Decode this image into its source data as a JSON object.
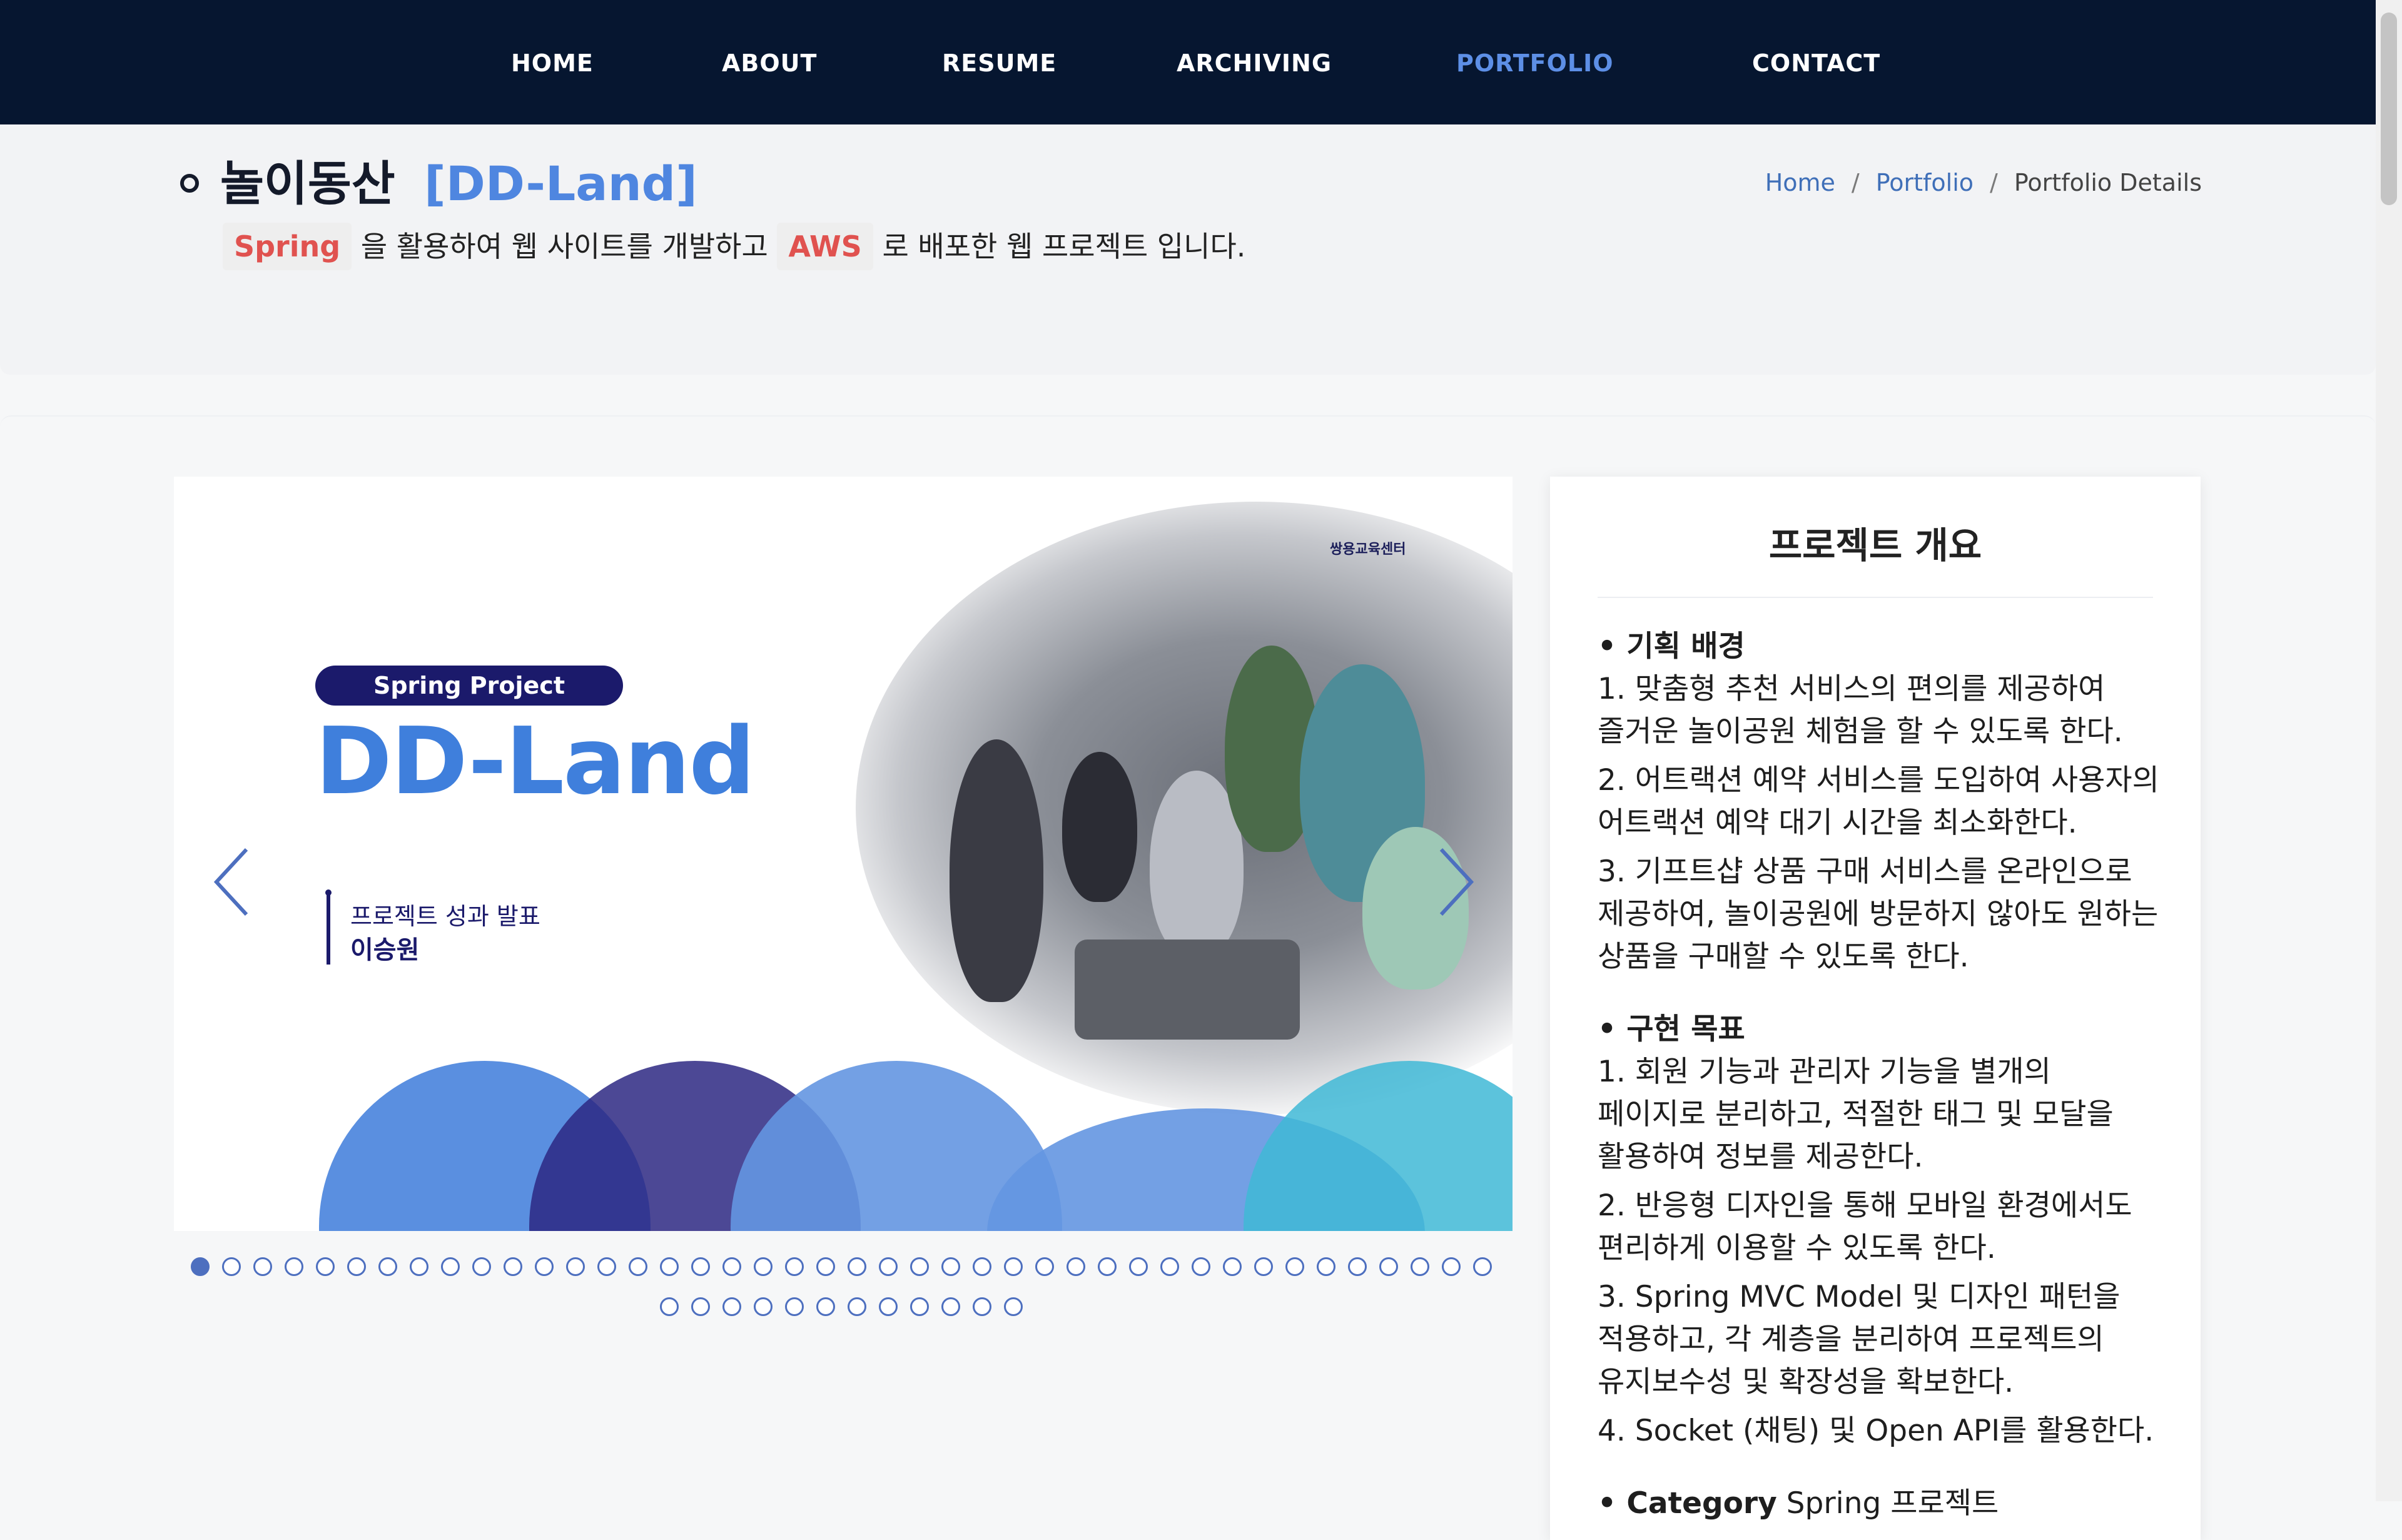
{
  "nav": {
    "items": [
      {
        "label": "HOME"
      },
      {
        "label": "ABOUT"
      },
      {
        "label": "RESUME"
      },
      {
        "label": "ARCHIVING"
      },
      {
        "label": "PORTFOLIO",
        "active": true
      },
      {
        "label": "CONTACT"
      }
    ]
  },
  "header": {
    "title_main": "놀이동산",
    "title_sub": "[DD-Land]",
    "subtitle": {
      "tech1": "Spring",
      "text1": "을 활용하여 웹 사이트를 개발하고",
      "tech2": "AWS",
      "text2": "로 배포한 웹 프로젝트 입니다."
    },
    "breadcrumb": {
      "home": "Home",
      "portfolio": "Portfolio",
      "current": "Portfolio Details",
      "separator": "/"
    }
  },
  "slide": {
    "logo": "쌍용교육센터",
    "pill": "Spring Project",
    "title": "DD-Land",
    "event": "프로젝트 성과 발표",
    "presenter": "이승원"
  },
  "pagination": {
    "total": 54,
    "current": 1
  },
  "overview": {
    "title": "프로젝트 개요",
    "background_heading": "• 기획 배경",
    "background_items": [
      "1. 맞춤형 추천 서비스의 편의를 제공하여 즐거운 놀이공원 체험을 할 수 있도록 한다.",
      "2. 어트랙션 예약 서비스를 도입하여 사용자의 어트랙션 예약 대기 시간을 최소화한다.",
      "3. 기프트샵 상품 구매 서비스를 온라인으로 제공하여, 놀이공원에 방문하지 않아도 원하는 상품을 구매할 수 있도록 한다."
    ],
    "goal_heading": "• 구현 목표",
    "goal_items": [
      "1. 회원 기능과 관리자 기능을 별개의 페이지로 분리하고, 적절한 태그 및 모달을 활용하여 정보를 제공한다.",
      "2. 반응형 디자인을 통해 모바일 환경에서도 편리하게 이용할 수 있도록 한다.",
      "3. Spring MVC Model 및 디자인 패턴을 적용하고, 각 계층을 분리하여 프로젝트의 유지보수성 및 확장성을 확보한다.",
      "4. Socket (채팅) 및 Open API를 활용한다."
    ],
    "category_label": "• Category",
    "category_value": "Spring 프로젝트"
  },
  "colors": {
    "nav_bg": "#061630",
    "nav_active": "#5d8fe6",
    "accent_blue": "#4f86e0",
    "tech_red": "#e0524f",
    "slide_navy": "#1b1a6b"
  }
}
